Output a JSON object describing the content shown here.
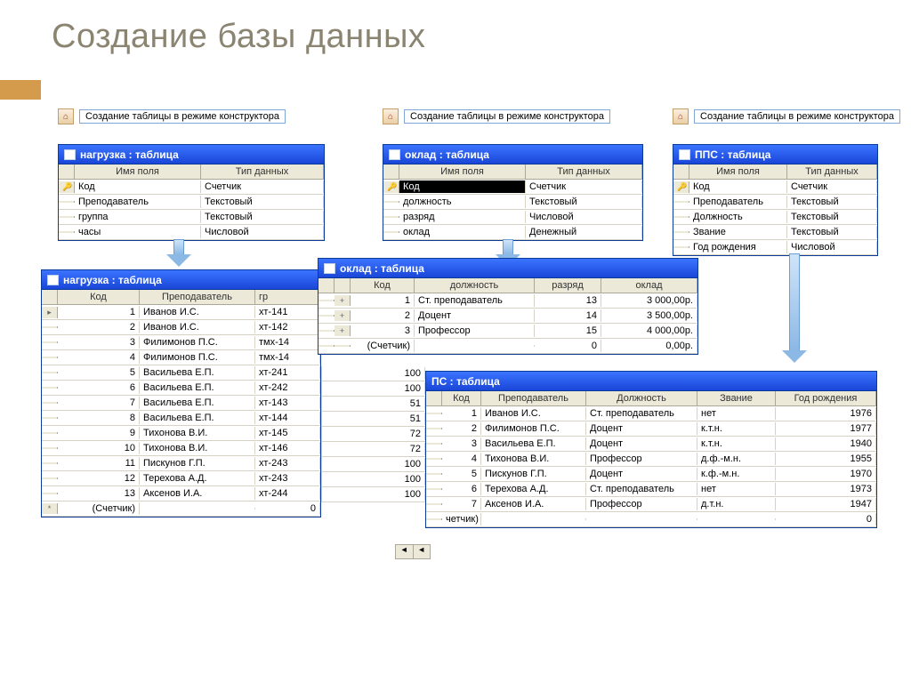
{
  "slide_title": "Создание базы данных",
  "design_link_label": "Создание таблицы в режиме конструктора",
  "col_name": "Имя поля",
  "col_type": "Тип данных",
  "counter_placeholder": "(Счетчик)",
  "nagruzka_struct": {
    "title": "нагрузка : таблица",
    "rows": [
      {
        "key": true,
        "name": "Код",
        "type": "Счетчик"
      },
      {
        "key": false,
        "name": "Преподаватель",
        "type": "Текстовый"
      },
      {
        "key": false,
        "name": "группа",
        "type": "Текстовый"
      },
      {
        "key": false,
        "name": "часы",
        "type": "Числовой"
      }
    ]
  },
  "oklad_struct": {
    "title": "оклад : таблица",
    "rows": [
      {
        "key": true,
        "name": "Код",
        "type": "Счетчик",
        "sel": true
      },
      {
        "key": false,
        "name": "должность",
        "type": "Текстовый"
      },
      {
        "key": false,
        "name": "разряд",
        "type": "Числовой"
      },
      {
        "key": false,
        "name": "оклад",
        "type": "Денежный"
      }
    ]
  },
  "pps_struct": {
    "title": "ППС : таблица",
    "rows": [
      {
        "key": true,
        "name": "Код",
        "type": "Счетчик"
      },
      {
        "key": false,
        "name": "Преподаватель",
        "type": "Текстовый"
      },
      {
        "key": false,
        "name": "Должность",
        "type": "Текстовый"
      },
      {
        "key": false,
        "name": "Звание",
        "type": "Текстовый"
      },
      {
        "key": false,
        "name": "Год рождения",
        "type": "Числовой"
      }
    ]
  },
  "nagruzka_data": {
    "title": "нагрузка : таблица",
    "cols": [
      "Код",
      "Преподаватель",
      "гр"
    ],
    "rows": [
      {
        "k": "1",
        "p": "Иванов И.С.",
        "g": "хт-141"
      },
      {
        "k": "2",
        "p": "Иванов И.С.",
        "g": "хт-142"
      },
      {
        "k": "3",
        "p": "Филимонов П.С.",
        "g": "тмх-14"
      },
      {
        "k": "4",
        "p": "Филимонов П.С.",
        "g": "тмх-14"
      },
      {
        "k": "5",
        "p": "Васильева Е.П.",
        "g": "хт-241",
        "h": "100"
      },
      {
        "k": "6",
        "p": "Васильева Е.П.",
        "g": "хт-242",
        "h": "100"
      },
      {
        "k": "7",
        "p": "Васильева Е.П.",
        "g": "хт-143",
        "h": "51"
      },
      {
        "k": "8",
        "p": "Васильева Е.П.",
        "g": "хт-144",
        "h": "51"
      },
      {
        "k": "9",
        "p": "Тихонова В.И.",
        "g": "хт-145",
        "h": "72"
      },
      {
        "k": "10",
        "p": "Тихонова В.И.",
        "g": "хт-146",
        "h": "72"
      },
      {
        "k": "11",
        "p": "Пискунов Г.П.",
        "g": "хт-243",
        "h": "100"
      },
      {
        "k": "12",
        "p": "Терехова А.Д.",
        "g": "хт-243",
        "h": "100"
      },
      {
        "k": "13",
        "p": "Аксенов И.А.",
        "g": "хт-244",
        "h": "100"
      }
    ],
    "footer_zero": "0"
  },
  "oklad_data": {
    "title": "оклад : таблица",
    "cols": [
      "Код",
      "должность",
      "разряд",
      "оклад"
    ],
    "rows": [
      {
        "k": "1",
        "d": "Ст. преподаватель",
        "r": "13",
        "o": "3 000,00р."
      },
      {
        "k": "2",
        "d": "Доцент",
        "r": "14",
        "o": "3 500,00р."
      },
      {
        "k": "3",
        "d": "Профессор",
        "r": "15",
        "o": "4 000,00р."
      }
    ],
    "footer_r": "0",
    "footer_o": "0,00р."
  },
  "pps_data": {
    "title": "ПС : таблица",
    "cols": [
      "Код",
      "Преподаватель",
      "Должность",
      "Звание",
      "Год рождения"
    ],
    "rows": [
      {
        "k": "1",
        "p": "Иванов И.С.",
        "d": "Ст. преподаватель",
        "z": "нет",
        "y": "1976"
      },
      {
        "k": "2",
        "p": "Филимонов П.С.",
        "d": "Доцент",
        "z": "к.т.н.",
        "y": "1977"
      },
      {
        "k": "3",
        "p": "Васильева Е.П.",
        "d": "Доцент",
        "z": "к.т.н.",
        "y": "1940"
      },
      {
        "k": "4",
        "p": "Тихонова В.И.",
        "d": "Профессор",
        "z": "д.ф.-м.н.",
        "y": "1955"
      },
      {
        "k": "5",
        "p": "Пискунов Г.П.",
        "d": "Доцент",
        "z": "к.ф.-м.н.",
        "y": "1970"
      },
      {
        "k": "6",
        "p": "Терехова А.Д.",
        "d": "Ст. преподаватель",
        "z": "нет",
        "y": "1973"
      },
      {
        "k": "7",
        "p": "Аксенов И.А.",
        "d": "Профессор",
        "z": "д.т.н.",
        "y": "1947"
      }
    ],
    "footer_label": "четчик)",
    "footer_zero": "0"
  }
}
